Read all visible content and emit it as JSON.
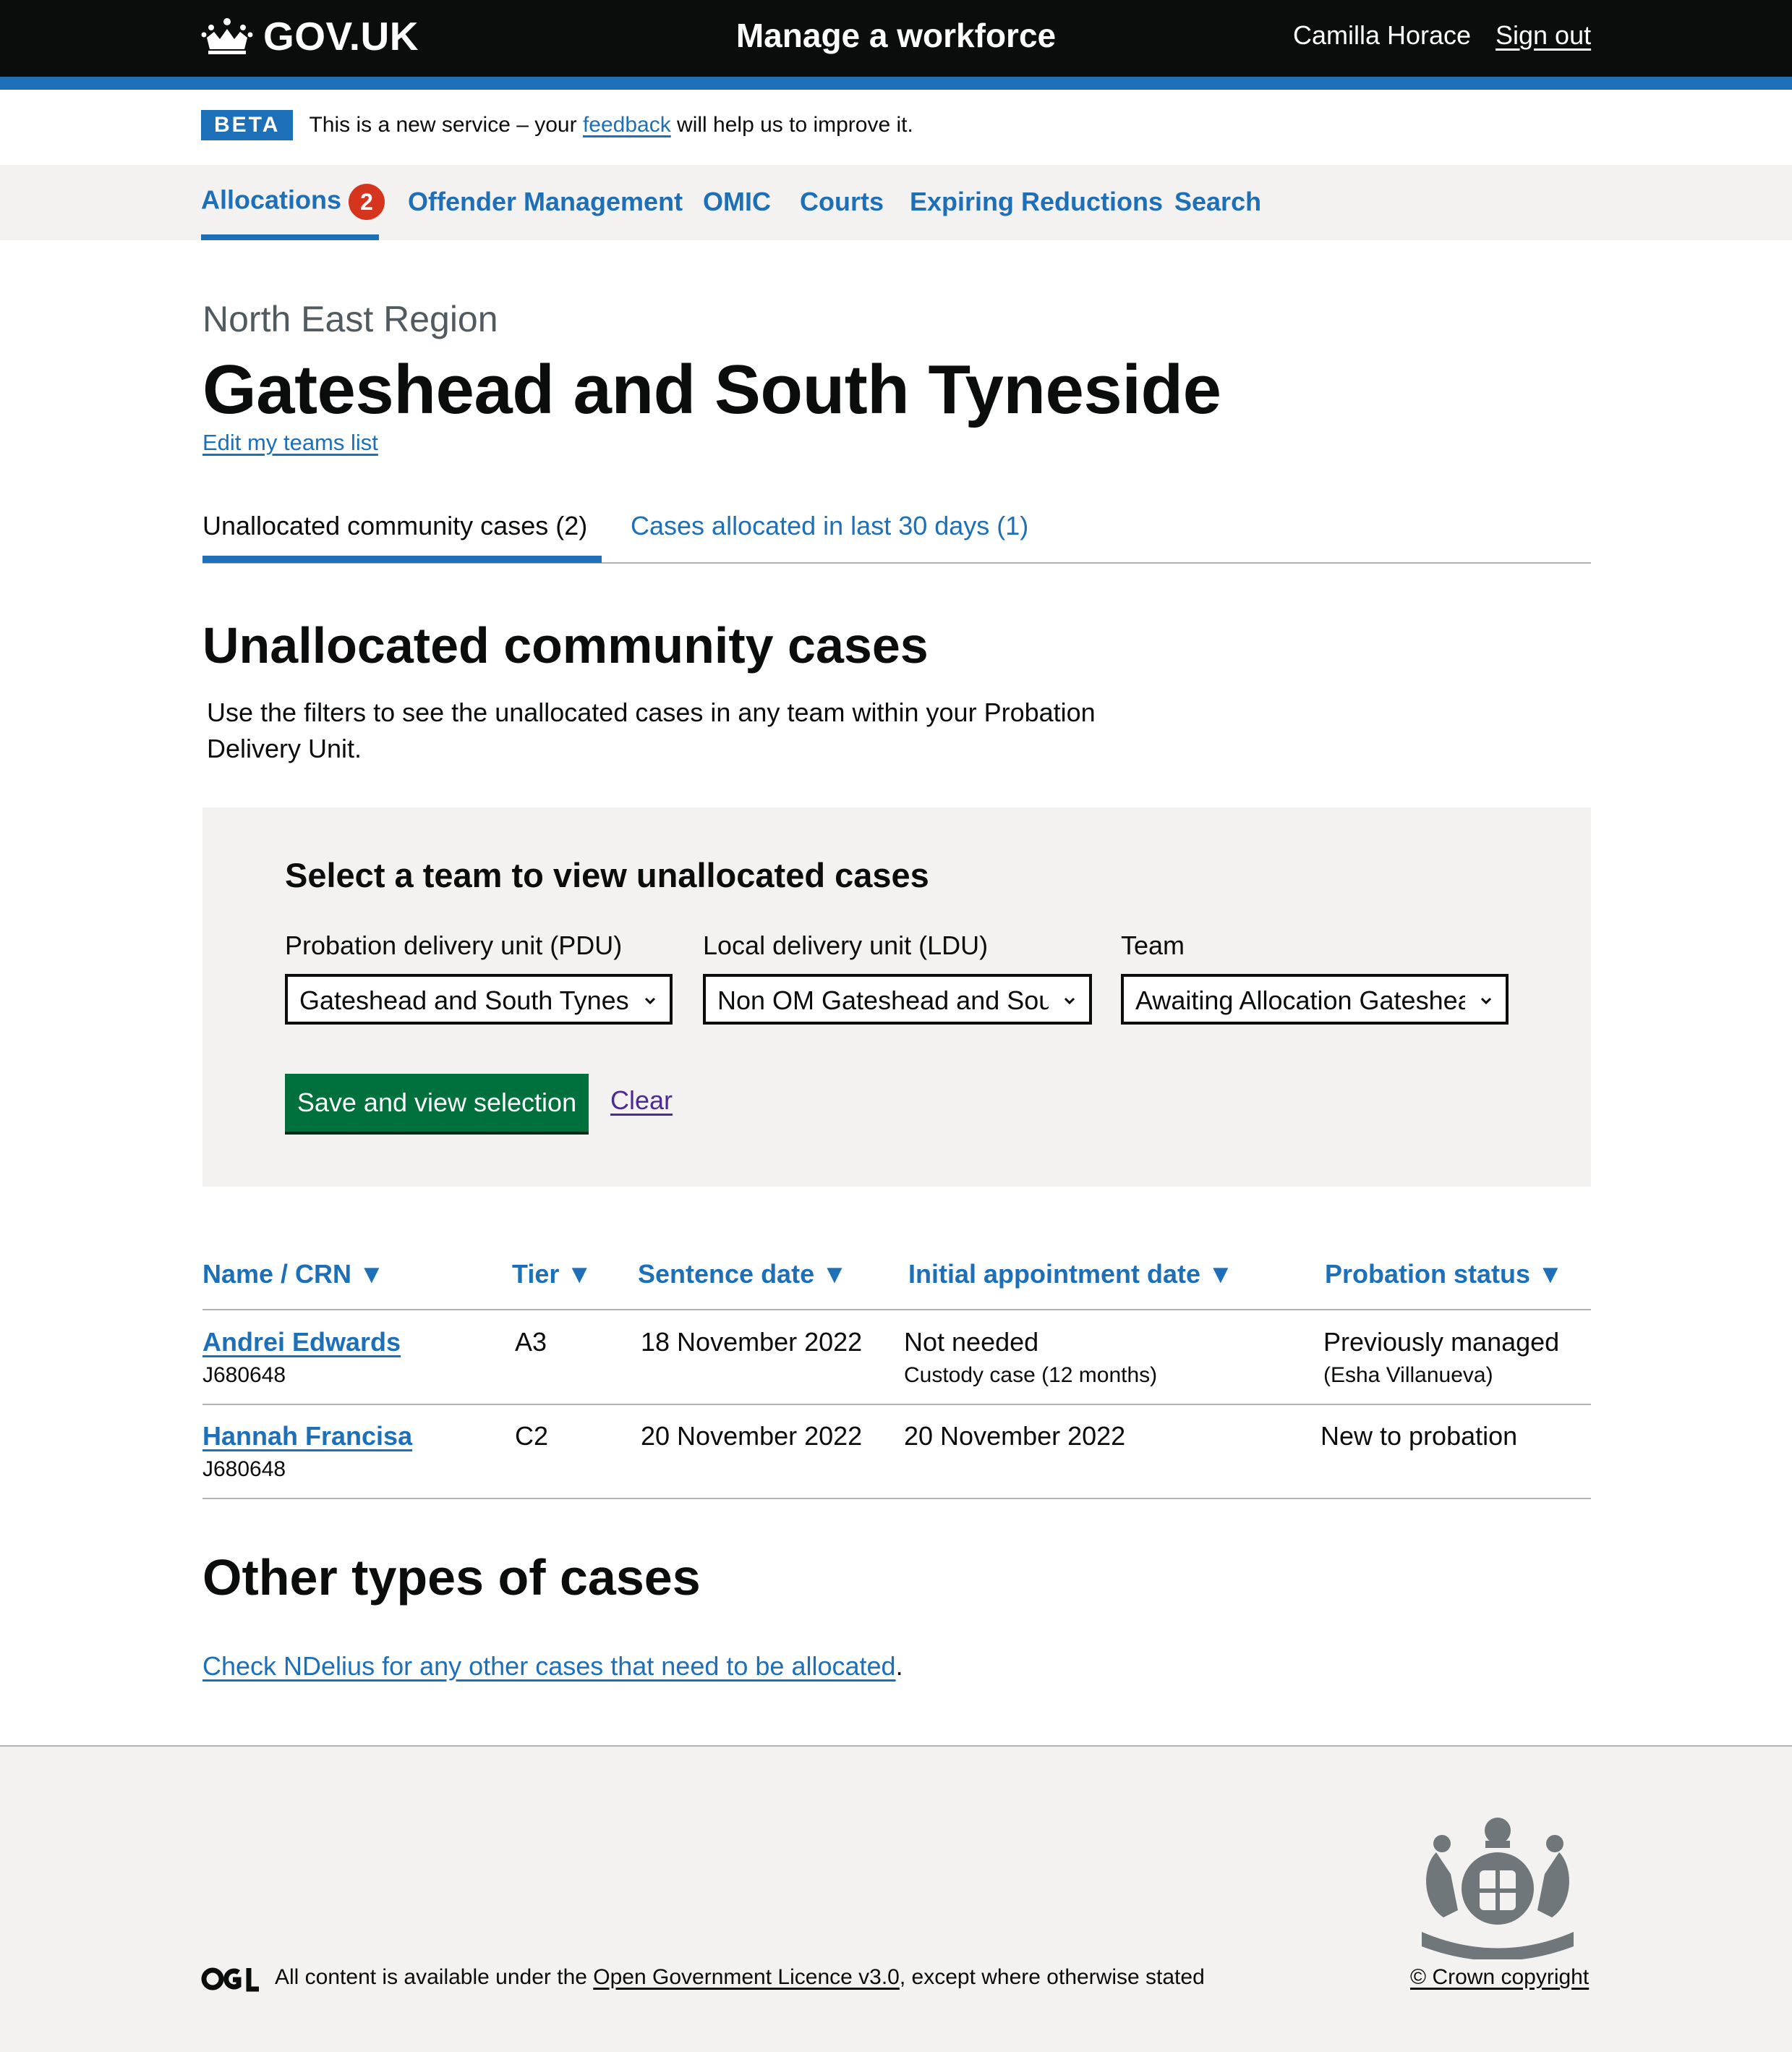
{
  "header": {
    "logo_text": "GOV.UK",
    "service_name": "Manage a workforce",
    "user_name": "Camilla Horace",
    "sign_out": "Sign out"
  },
  "phase_banner": {
    "tag": "BETA",
    "text_before": "This is a new service – your ",
    "link": "feedback",
    "text_after": " will help us to improve it."
  },
  "nav": {
    "items": [
      {
        "label": "Allocations",
        "badge": "2",
        "active": true
      },
      {
        "label": "Offender Management"
      },
      {
        "label": "OMIC"
      },
      {
        "label": "Courts"
      },
      {
        "label": "Expiring Reductions"
      },
      {
        "label": "Search"
      }
    ]
  },
  "page": {
    "caption": "North East Region",
    "title": "Gateshead and South Tyneside",
    "edit_link": "Edit my teams list"
  },
  "tabs": [
    {
      "label": "Unallocated community cases (2)",
      "active": true
    },
    {
      "label": "Cases allocated in last 30 days (1)",
      "active": false
    }
  ],
  "section": {
    "heading": "Unallocated community cases",
    "intro": "Use the filters to see the unallocated cases in any team within your Probation Delivery Unit."
  },
  "filter": {
    "heading": "Select a team to view unallocated cases",
    "pdu": {
      "label": "Probation delivery unit (PDU)",
      "value": "Gateshead and South Tyneside"
    },
    "ldu": {
      "label": "Local delivery unit (LDU)",
      "value": "Non OM Gateshead and South Tyneside"
    },
    "team": {
      "label": "Team",
      "value": "Awaiting Allocation Gateshead"
    },
    "save_button": "Save and view selection",
    "clear_link": "Clear"
  },
  "table": {
    "headers": [
      "Name / CRN ▼",
      "Tier ▼",
      "Sentence date ▼",
      "Initial appointment date ▼",
      "Probation status ▼"
    ],
    "rows": [
      {
        "name": "Andrei Edwards",
        "crn": "J680648",
        "tier": "A3",
        "sentence_date": "18 November 2022",
        "initial_appointment": "Not needed",
        "initial_appointment_note": "Custody case (12 months)",
        "status": "Previously managed",
        "status_note": "(Esha Villanueva)"
      },
      {
        "name": "Hannah Francisa",
        "crn": "J680648",
        "tier": "C2",
        "sentence_date": "20 November 2022",
        "initial_appointment": "20 November 2022",
        "initial_appointment_note": "",
        "status": "New to probation",
        "status_note": ""
      }
    ]
  },
  "other": {
    "heading": "Other types of cases",
    "link": "Check NDelius for any other cases that need to be allocated",
    "after": "."
  },
  "footer": {
    "licence_before": "All content is available under the ",
    "licence_link": "Open Government Licence v3.0",
    "licence_after": ", except where otherwise stated",
    "copyright": "© Crown copyright"
  },
  "icons": {
    "crown": "crown-icon",
    "chevron": "chevron-down-icon",
    "ogl": "ogl-logo",
    "crest": "royal-coat-of-arms"
  },
  "colors": {
    "brand_blue": "#1d70b8",
    "header_black": "#0b0c0c",
    "button_green": "#00703c",
    "badge_red": "#d4351c",
    "panel_grey": "#f3f2f1",
    "visited_purple": "#4c2c92"
  }
}
